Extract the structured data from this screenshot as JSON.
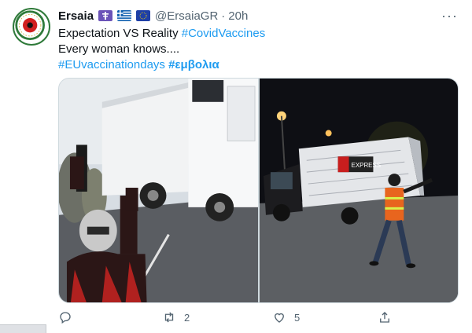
{
  "tweet": {
    "author_name": "Ersaia",
    "handle": "@ErsaiaGR",
    "separator": "·",
    "time": "20h",
    "more_label": "···",
    "lines": {
      "line1_plain": "Expectation VS Reality ",
      "line1_tag": "#CovidVaccines",
      "line2": "Every woman knows....",
      "line3_tag1": "#EUvaccinationdays",
      "line3_tag2": "#εμβολια"
    },
    "media": {
      "left_image": "woman-waving-at-white-truck",
      "right_image": "man-waving-at-van-at-night",
      "van_logo_text": "EXPRESS"
    },
    "actions": {
      "reply_icon": "reply-icon",
      "retweet_icon": "retweet-icon",
      "retweet_count": "2",
      "like_icon": "heart-icon",
      "like_count": "5",
      "share_icon": "share-icon"
    }
  },
  "colors": {
    "link": "#1d9bf0",
    "secondary": "#536471",
    "border": "#cfd9de"
  }
}
